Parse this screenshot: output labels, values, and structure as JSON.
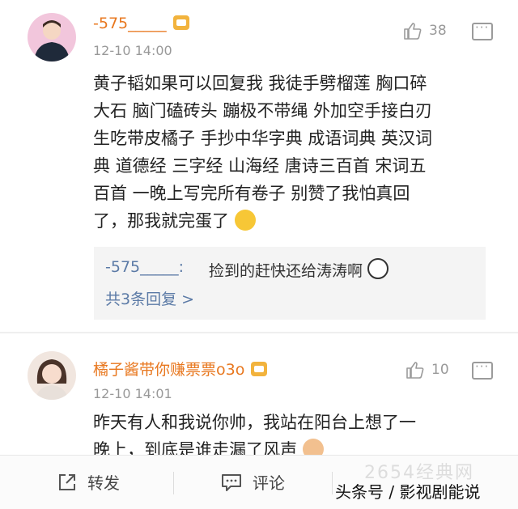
{
  "comments": [
    {
      "username": "-575_____",
      "time": "12-10 14:00",
      "likes": "38",
      "text_lines": [
        "黄子韬如果可以回复我 我徒手劈榴莲 胸口碎",
        "大石 脑门磕砖头 蹦极不带绳 外加空手接白刃",
        "生吃带皮橘子 手抄中华字典 成语词典 英汉词",
        "典 道德经 三字经 山海经 唐诗三百首 宋词五",
        "百首 一晚上写完所有卷子 别赞了我怕真回",
        "了，那我就完蛋了"
      ],
      "emoji": "laughing-crying-emoji",
      "replies": {
        "first_reply_user": "-575_____:",
        "first_reply_text": "捡到的赶快还给涛涛啊",
        "reply_emoji": "panda-emoji",
        "more_replies": "共3条回复 >"
      }
    },
    {
      "username": "橘子酱带你赚票票o3o",
      "time": "12-10 14:01",
      "likes": "10",
      "text_lines": [
        "昨天有人和我说你帅，我站在阳台上想了一",
        "晚上，到底是谁走漏了风声"
      ],
      "emoji": "cat-emoji"
    }
  ],
  "toolbar": {
    "repost_label": "转发",
    "comment_label": "评论"
  },
  "watermark": {
    "main": "头条号 / 影视剧能说",
    "faint": "2654经典网"
  },
  "colors": {
    "username": "#e8771e",
    "link_blue": "#5b7aa6",
    "muted": "#999999",
    "vip_badge": "#f2b33d"
  }
}
